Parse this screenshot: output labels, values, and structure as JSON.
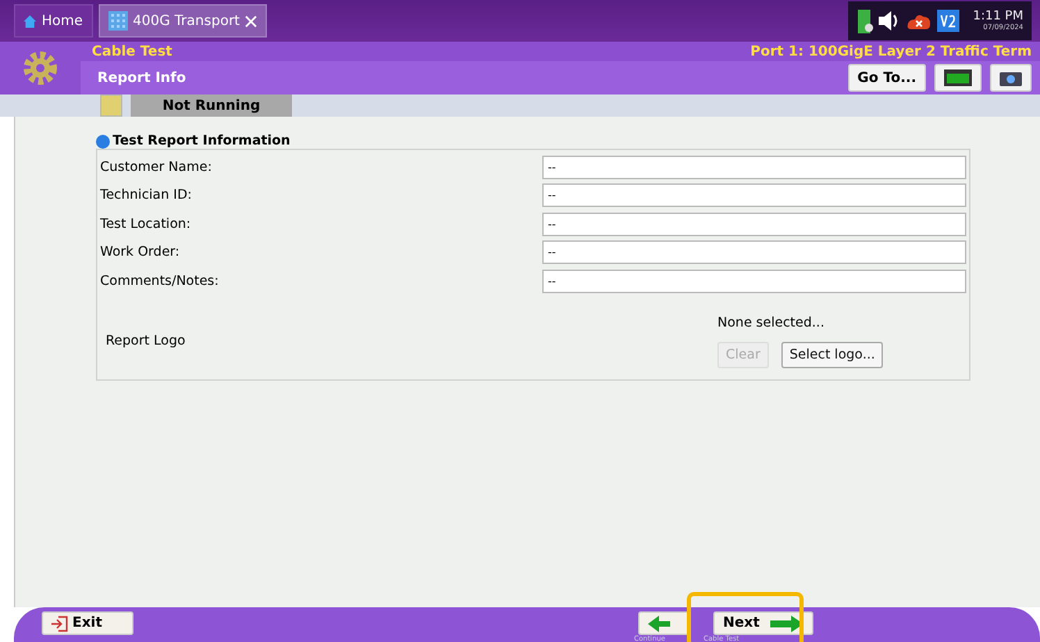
{
  "tabs": [
    {
      "label": "Home",
      "selected": false
    },
    {
      "label": "400G Transport",
      "selected": true
    }
  ],
  "status": {
    "time": "1:11 PM",
    "date": "07/09/2024"
  },
  "header": {
    "test": "Cable Test",
    "page": "Report Info",
    "port": "Port 1: 100GigE Layer 2 Traffic Term",
    "goto": "Go To..."
  },
  "run_state": {
    "label": "Not Running"
  },
  "section": {
    "title": "Test Report Information"
  },
  "fields": [
    {
      "label": "Customer Name:",
      "value": "--"
    },
    {
      "label": "Technician ID:",
      "value": "--"
    },
    {
      "label": "Test Location:",
      "value": "--"
    },
    {
      "label": "Work Order:",
      "value": "--"
    },
    {
      "label": "Comments/Notes:",
      "value": "--"
    }
  ],
  "logo": {
    "label": "Report Logo",
    "status": "None selected...",
    "clear": {
      "label": "Clear",
      "disabled": true
    },
    "select": {
      "label": "Select logo...",
      "disabled": false
    }
  },
  "footer": {
    "exit": "Exit",
    "back_caption": "Continue",
    "next": "Next",
    "next_caption": "Cable Test",
    "next_highlighted": true
  }
}
